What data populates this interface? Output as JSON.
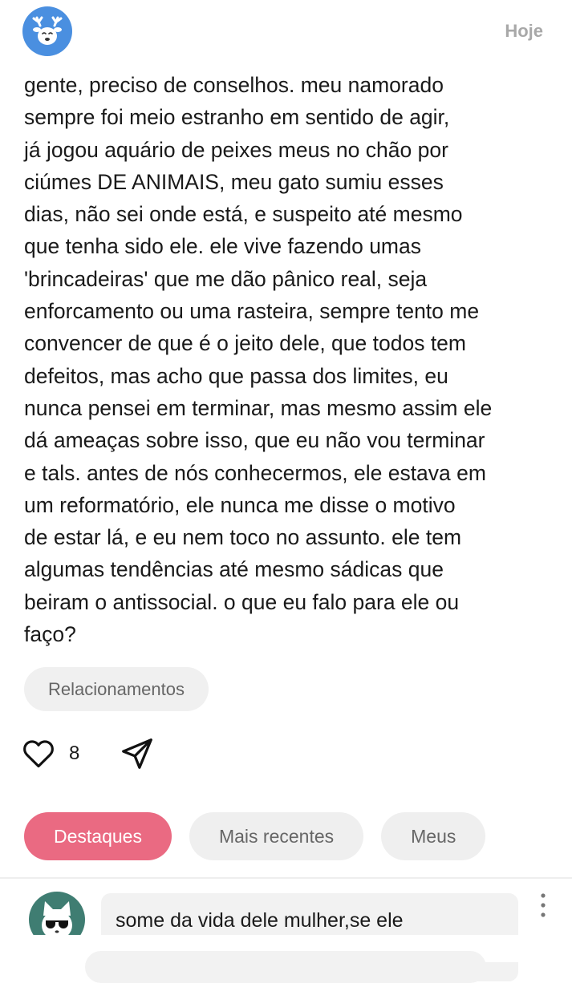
{
  "post": {
    "date": "Hoje",
    "avatar_icon": "deer-icon",
    "body": "gente, preciso de conselhos. meu namorado\nsempre foi meio estranho em sentido de agir,\njá jogou aquário de peixes meus no chão por\nciúmes DE ANIMAIS, meu gato sumiu esses\ndias, não sei onde está, e suspeito até mesmo\nque tenha sido ele. ele vive fazendo umas\n'brincadeiras' que me dão pânico real, seja\nenforcamento ou uma rasteira, sempre tento me\nconvencer de que é o jeito dele, que todos tem\ndefeitos, mas acho que passa dos limites, eu\nnunca pensei em terminar, mas mesmo assim ele\ndá ameaças sobre isso, que eu não vou terminar\ne tals. antes de nós conhecermos, ele estava em\num reformatório, ele nunca me disse o motivo\nde estar lá, e eu nem toco no assunto. ele tem\nalgumas tendências até mesmo sádicas que\nbeiram o antissocial. o que eu falo para ele ou\nfaço?",
    "tag": "Relacionamentos",
    "likes": "8"
  },
  "tabs": [
    {
      "label": "Destaques",
      "active": true
    },
    {
      "label": "Mais recentes",
      "active": false
    },
    {
      "label": "Meus",
      "active": false
    }
  ],
  "comment": {
    "text": "some da vida dele mulher,se ele",
    "avatar_icon": "cat-sunglasses-icon"
  },
  "colors": {
    "accent": "#ea6a82",
    "avatar_bg": "#4a8fe0",
    "comment_avatar_bg": "#3f7d72",
    "chip_bg": "#f0f0f0",
    "muted_text": "#a8a8a8"
  }
}
